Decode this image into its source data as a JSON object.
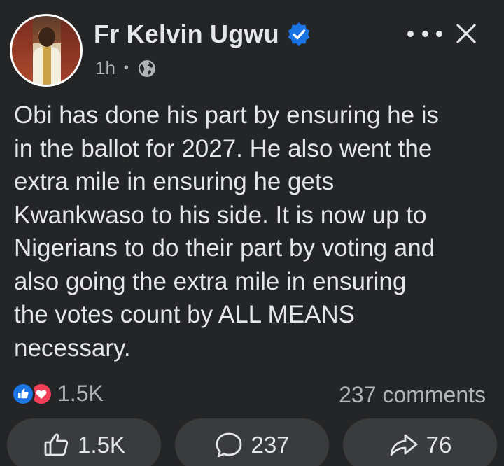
{
  "author": {
    "name": "Fr Kelvin Ugwu",
    "verified": true,
    "time": "1h",
    "separator": "•",
    "audience_icon": "globe-icon"
  },
  "header": {
    "more_icon": "more-options-icon",
    "close_icon": "close-icon"
  },
  "post": {
    "text": "Obi has done his part by ensuring he is\nin the ballot for 2027. He also went the\nextra mile in ensuring he gets\nKwankwaso to his side. It is now up to\nNigerians to do their part by voting and\nalso going the extra mile in ensuring\nthe votes count by ALL MEANS\nnecessary."
  },
  "summary": {
    "reaction_icons": [
      "like-reaction-icon",
      "love-reaction-icon"
    ],
    "reaction_count": "1.5K",
    "comments_label": "237 comments"
  },
  "actions": {
    "like_count": "1.5K",
    "comment_count": "237",
    "share_count": "76"
  },
  "colors": {
    "background": "#242526",
    "button_bg": "#3a3b3c",
    "text_primary": "#e4e6eb",
    "text_secondary": "#b0b3b8",
    "verified_blue": "#1b74e4",
    "like_blue": "#1b74e4",
    "love_red": "#f33e58"
  }
}
